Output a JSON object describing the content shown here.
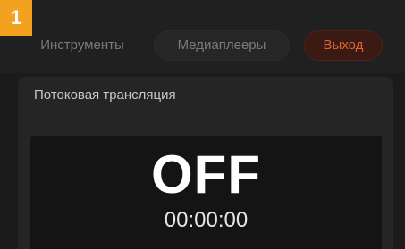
{
  "badge": {
    "number": "1"
  },
  "tabs": [
    {
      "label": "Инструменты",
      "active": false
    },
    {
      "label": "Медиаплееры",
      "active": false
    },
    {
      "label": "Выход",
      "active": true
    }
  ],
  "section": {
    "title": "Потоковая трансляция"
  },
  "stream": {
    "status": "OFF",
    "timer": "00:00:00"
  },
  "colors": {
    "accent_orange": "#e0633a",
    "badge": "#f3a21f",
    "panel_bg": "#252525",
    "display_bg": "#141414"
  }
}
